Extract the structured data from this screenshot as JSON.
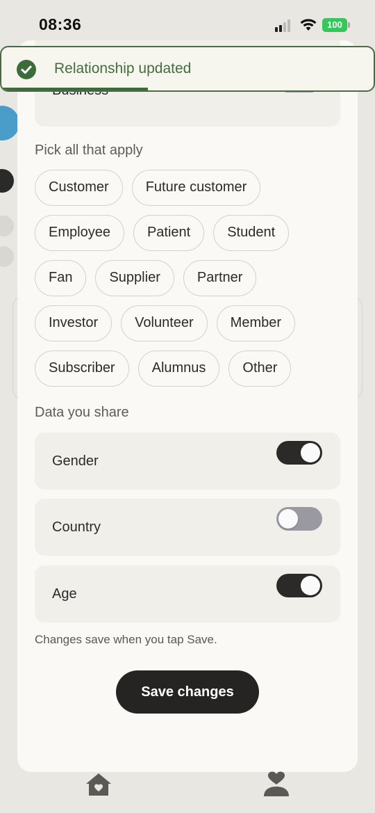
{
  "status_bar": {
    "time": "08:36",
    "battery": "100",
    "icons": [
      "signal-icon",
      "wifi-icon",
      "battery-icon"
    ]
  },
  "toast": {
    "message": "Relationship updated",
    "icon": "check-circle-icon",
    "progress_fraction": 0.39,
    "accent": "#3e6b3a"
  },
  "business_row": {
    "label": "Business",
    "enabled": false
  },
  "categories": {
    "title": "Pick all that apply",
    "chips": [
      [
        "Customer",
        "Future customer"
      ],
      [
        "Employee",
        "Patient",
        "Student"
      ],
      [
        "Fan",
        "Supplier",
        "Partner"
      ],
      [
        "Investor",
        "Volunteer",
        "Member"
      ],
      [
        "Subscriber",
        "Alumnus",
        "Other"
      ]
    ]
  },
  "data_share": {
    "title": "Data you share",
    "items": [
      {
        "label": "Gender",
        "enabled": true
      },
      {
        "label": "Country",
        "enabled": false
      },
      {
        "label": "Age",
        "enabled": true
      }
    ]
  },
  "footnote": "Changes save when you tap Save.",
  "save_button": "Save changes",
  "tab_bar": {
    "icons": [
      "home-icon",
      "heart-person-icon"
    ]
  },
  "colors": {
    "background": "#e9e7e2",
    "sheet": "#faf9f6",
    "primary": "#252422",
    "toggle_off": "#9a98a0"
  }
}
